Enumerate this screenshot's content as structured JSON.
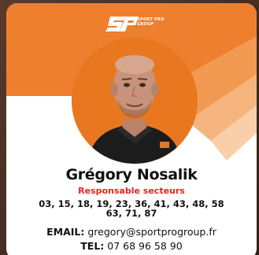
{
  "logo": {
    "mark": "SP",
    "text": "SPORT PRO GROUP"
  },
  "person": {
    "name": "Grégory Nosalik",
    "role": "Responsable secteurs",
    "departments": "03, 15, 18, 19, 23, 36, 41, 43, 48, 58 63, 71, 87"
  },
  "contact": {
    "email_label": "EMAIL:",
    "email": "gregory@sportprogroup.fr",
    "tel_label": "TEL:",
    "tel": "07 68 96 58 90"
  },
  "colors": {
    "brand_orange": "#ee7f2e",
    "role_red": "#e4261c",
    "text": "#111111"
  },
  "icons": [
    "sport-pro-group-logo",
    "profile-photo"
  ]
}
